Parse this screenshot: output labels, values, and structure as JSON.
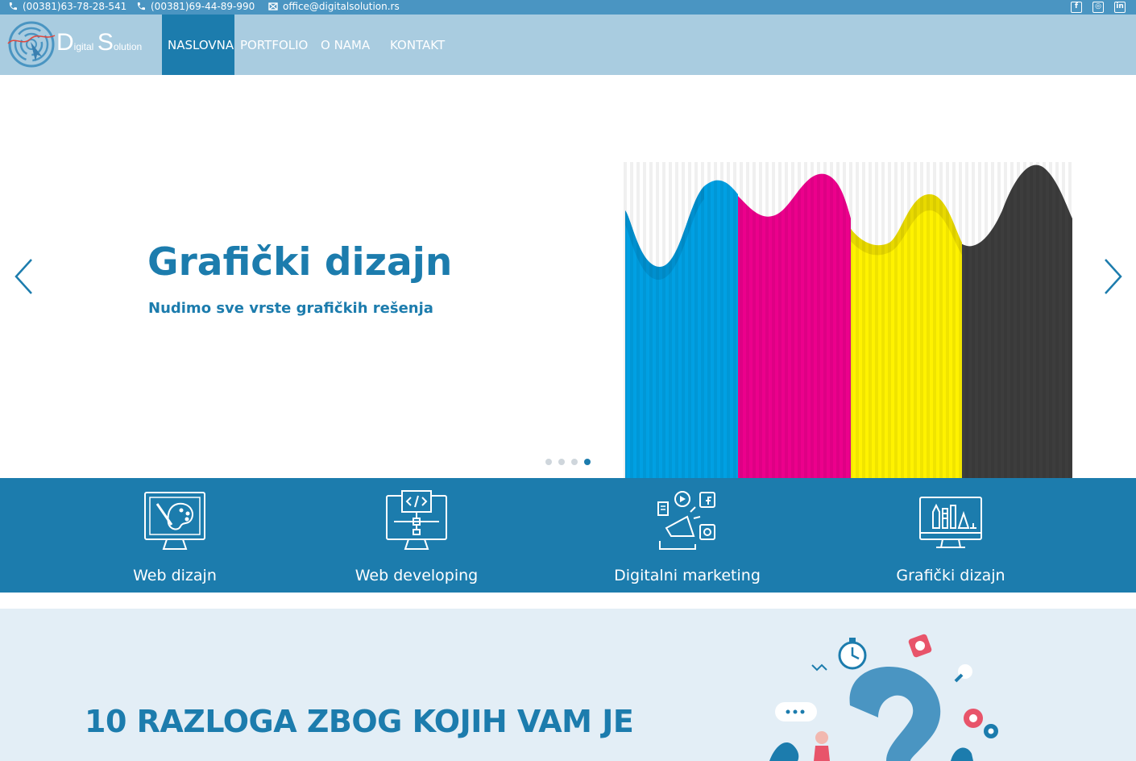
{
  "topbar": {
    "phone1": "(00381)63-78-28-541",
    "phone2": "(00381)69-44-89-990",
    "email": "office@digitalsolution.rs",
    "social": [
      {
        "icon": "facebook-icon",
        "glyph": "f"
      },
      {
        "icon": "instagram-icon",
        "glyph": "◎"
      },
      {
        "icon": "linkedin-icon",
        "glyph": "in"
      }
    ]
  },
  "logo": {
    "d": "D",
    "igital": "igital",
    "s": "S",
    "olution": "olution"
  },
  "nav": {
    "items": [
      "NASLOVNA",
      "PORTFOLIO",
      "O NAMA",
      "KONTAKT"
    ],
    "active": "NASLOVNA"
  },
  "hero": {
    "title": "Grafički dizajn",
    "subtitle": "Nudimo sve vrste grafičkih rešenja",
    "slide_count": 4,
    "active_slide": 4,
    "colors": [
      "#00a0e3",
      "#ec008c",
      "#fff200",
      "#3a3a3a"
    ]
  },
  "services": [
    {
      "label": "Web dizajn",
      "icon": "monitor-palette-icon"
    },
    {
      "label": "Web developing",
      "icon": "monitor-code-icon"
    },
    {
      "label": "Digitalni marketing",
      "icon": "megaphone-social-icon"
    },
    {
      "label": "Grafički dizajn",
      "icon": "monitor-tools-icon"
    }
  ],
  "reasons": {
    "title": "10 RAZLOGA ZBOG KOJIH VAM JE",
    "accent": "#1c7cad"
  }
}
